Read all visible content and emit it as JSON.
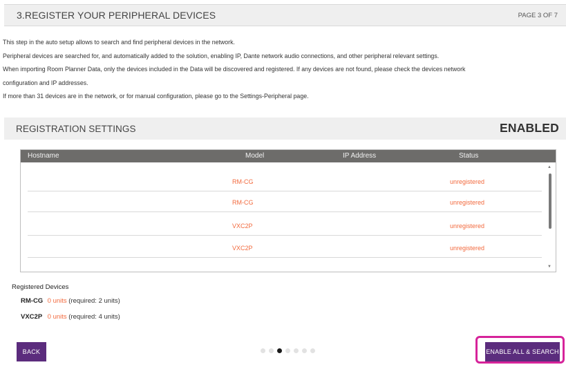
{
  "header": {
    "title": "3.REGISTER YOUR PERIPHERAL DEVICES",
    "page_indicator": "PAGE 3 OF 7"
  },
  "intro": {
    "line1": "This step in the auto setup allows to search and find peripheral devices in the network.",
    "line2": "Peripheral devices are searched for, and automatically added to the solution, enabling IP, Dante network audio connections, and other peripheral relevant settings.",
    "line3": "When importing Room Planner Data, only the devices included in the Data will be discovered and registered. If any devices are not found, please check the devices network",
    "line4": "configuration and IP addresses.",
    "line5": "If more than 31 devices are in the network, or for manual configuration, please go to the Settings-Peripheral page."
  },
  "registration": {
    "title": "REGISTRATION SETTINGS",
    "status": "ENABLED"
  },
  "table": {
    "columns": {
      "hostname": "Hostname",
      "model": "Model",
      "ip": "IP Address",
      "status": "Status"
    },
    "rows": [
      {
        "hostname": "",
        "model": "RM-CG",
        "ip": "",
        "status": "unregistered"
      },
      {
        "hostname": "",
        "model": "RM-CG",
        "ip": "",
        "status": "unregistered"
      },
      {
        "hostname": "",
        "model": "VXC2P",
        "ip": "",
        "status": "unregistered"
      },
      {
        "hostname": "",
        "model": "VXC2P",
        "ip": "",
        "status": "unregistered"
      }
    ]
  },
  "registered_devices": {
    "heading": "Registered Devices",
    "items": [
      {
        "name": "RM-CG",
        "units": "0 units",
        "required": "(required: 2 units)"
      },
      {
        "name": "VXC2P",
        "units": "0 units",
        "required": "(required: 4 units)"
      }
    ]
  },
  "footer": {
    "back_label": "BACK",
    "enable_label": "ENABLE ALL & SEARCH",
    "total_pages": 7,
    "current_page": 3
  },
  "colors": {
    "accent": "#5b2c7d",
    "warning": "#f26a3e",
    "highlight": "#d6239a",
    "table_header": "#6d6c6a"
  }
}
